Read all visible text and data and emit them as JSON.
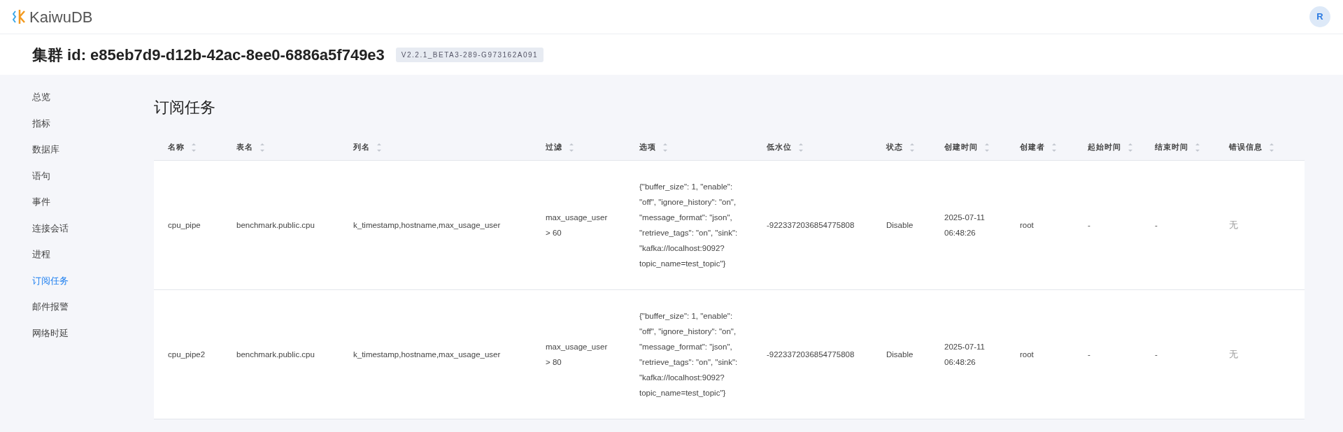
{
  "header": {
    "logo_text": "KaiwuDB",
    "avatar": "R"
  },
  "cluster": {
    "title": "集群 id: e85eb7d9-d12b-42ac-8ee0-6886a5f749e3",
    "version": "V2.2.1_BETA3-289-G973162A091"
  },
  "sidebar": {
    "items": [
      {
        "label": "总览",
        "selected": false
      },
      {
        "label": "指标",
        "selected": false
      },
      {
        "label": "数据库",
        "selected": false
      },
      {
        "label": "语句",
        "selected": false
      },
      {
        "label": "事件",
        "selected": false
      },
      {
        "label": "连接会话",
        "selected": false
      },
      {
        "label": "进程",
        "selected": false
      },
      {
        "label": "订阅任务",
        "selected": true
      },
      {
        "label": "邮件报警",
        "selected": false
      },
      {
        "label": "网络时延",
        "selected": false
      }
    ]
  },
  "page_title": "订阅任务",
  "table": {
    "columns": [
      "名称",
      "表名",
      "列名",
      "过滤",
      "选项",
      "低水位",
      "状态",
      "创建时间",
      "创建者",
      "起始时间",
      "结束时间",
      "错误信息"
    ],
    "rows": [
      [
        "cpu_pipe",
        "benchmark.public.cpu",
        "k_timestamp,hostname,max_usage_user",
        "max_usage_user > 60",
        "{\"buffer_size\": 1, \"enable\": \"off\", \"ignore_history\": \"on\", \"message_format\": \"json\", \"retrieve_tags\": \"on\", \"sink\": \"kafka://localhost:9092?topic_name=test_topic\"}",
        "-9223372036854775808",
        "Disable",
        "2025-07-11 06:48:26",
        "root",
        "-",
        "-",
        "无"
      ],
      [
        "cpu_pipe2",
        "benchmark.public.cpu",
        "k_timestamp,hostname,max_usage_user",
        "max_usage_user > 80",
        "{\"buffer_size\": 1, \"enable\": \"off\", \"ignore_history\": \"on\", \"message_format\": \"json\", \"retrieve_tags\": \"on\", \"sink\": \"kafka://localhost:9092?topic_name=test_topic\"}",
        "-9223372036854775808",
        "Disable",
        "2025-07-11 06:48:26",
        "root",
        "-",
        "-",
        "无"
      ]
    ]
  }
}
